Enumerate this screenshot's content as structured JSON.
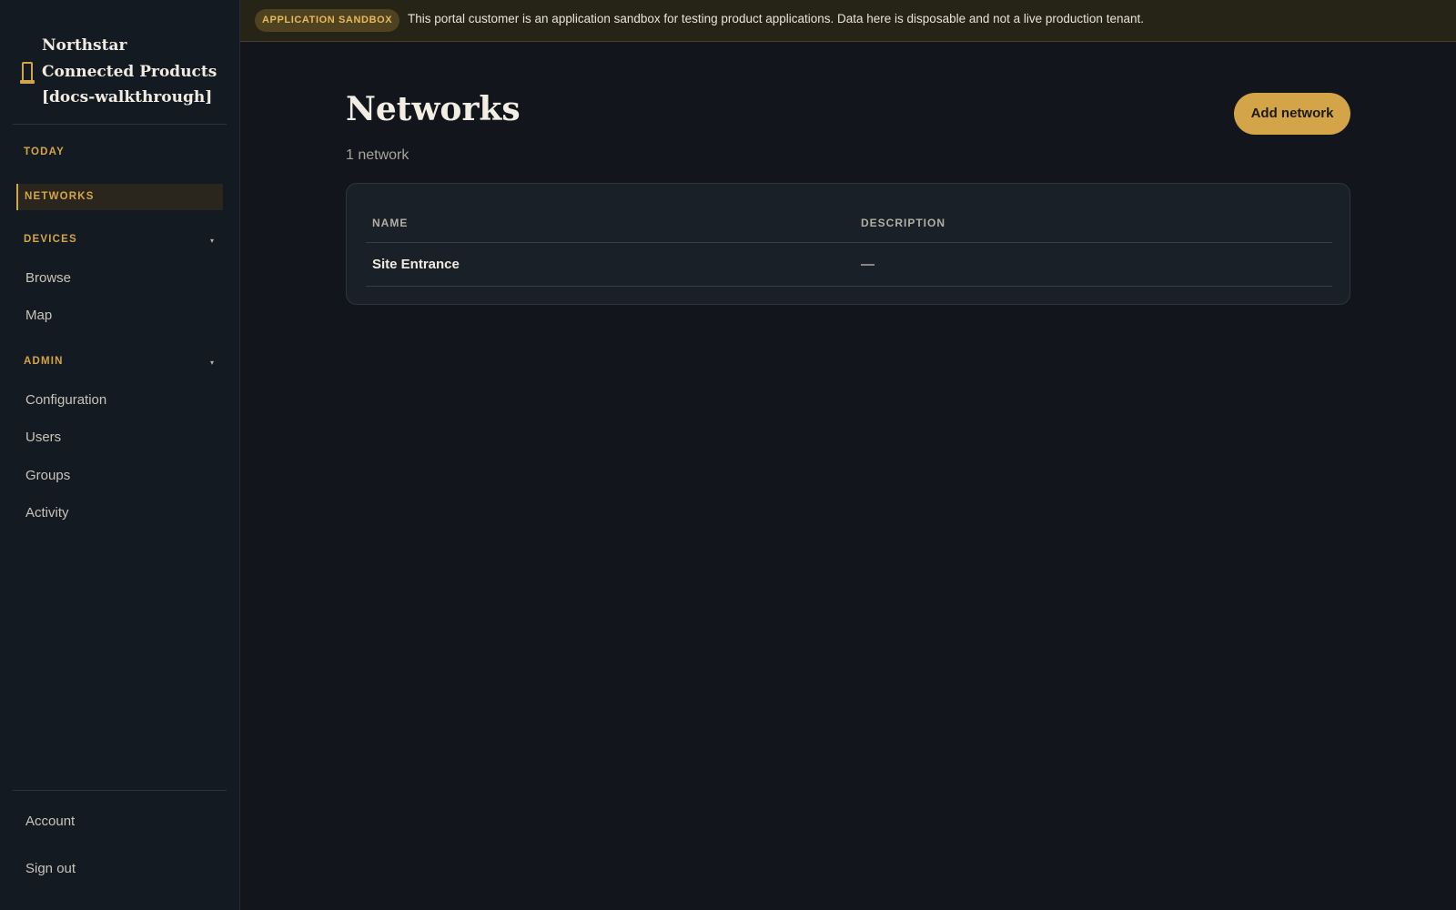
{
  "sidebar": {
    "brand_title": "Northstar Connected Products [docs-walkthrough]",
    "brand_icon": "bookmark-icon",
    "today_label": "TODAY",
    "networks_label": "NETWORKS",
    "devices_label": "DEVICES",
    "devices_items": [
      "Browse",
      "Map"
    ],
    "admin_label": "ADMIN",
    "admin_items": [
      "Configuration",
      "Users",
      "Groups",
      "Activity"
    ],
    "account_label": "Account",
    "signout_label": "Sign out",
    "caret_glyph": "▾"
  },
  "banner": {
    "badge": "APPLICATION SANDBOX",
    "text": "This portal customer is an application sandbox for testing product applications. Data here is disposable and not a live production tenant."
  },
  "main": {
    "title": "Networks",
    "subtitle": "1 network",
    "add_button": "Add network",
    "table": {
      "columns": [
        "NAME",
        "DESCRIPTION"
      ],
      "rows": [
        {
          "name": "Site Entrance",
          "description": "—"
        }
      ]
    }
  },
  "colors": {
    "accent": "#d4a548",
    "background": "#12161c",
    "sidebar": "#141a21",
    "banner": "#262317"
  }
}
